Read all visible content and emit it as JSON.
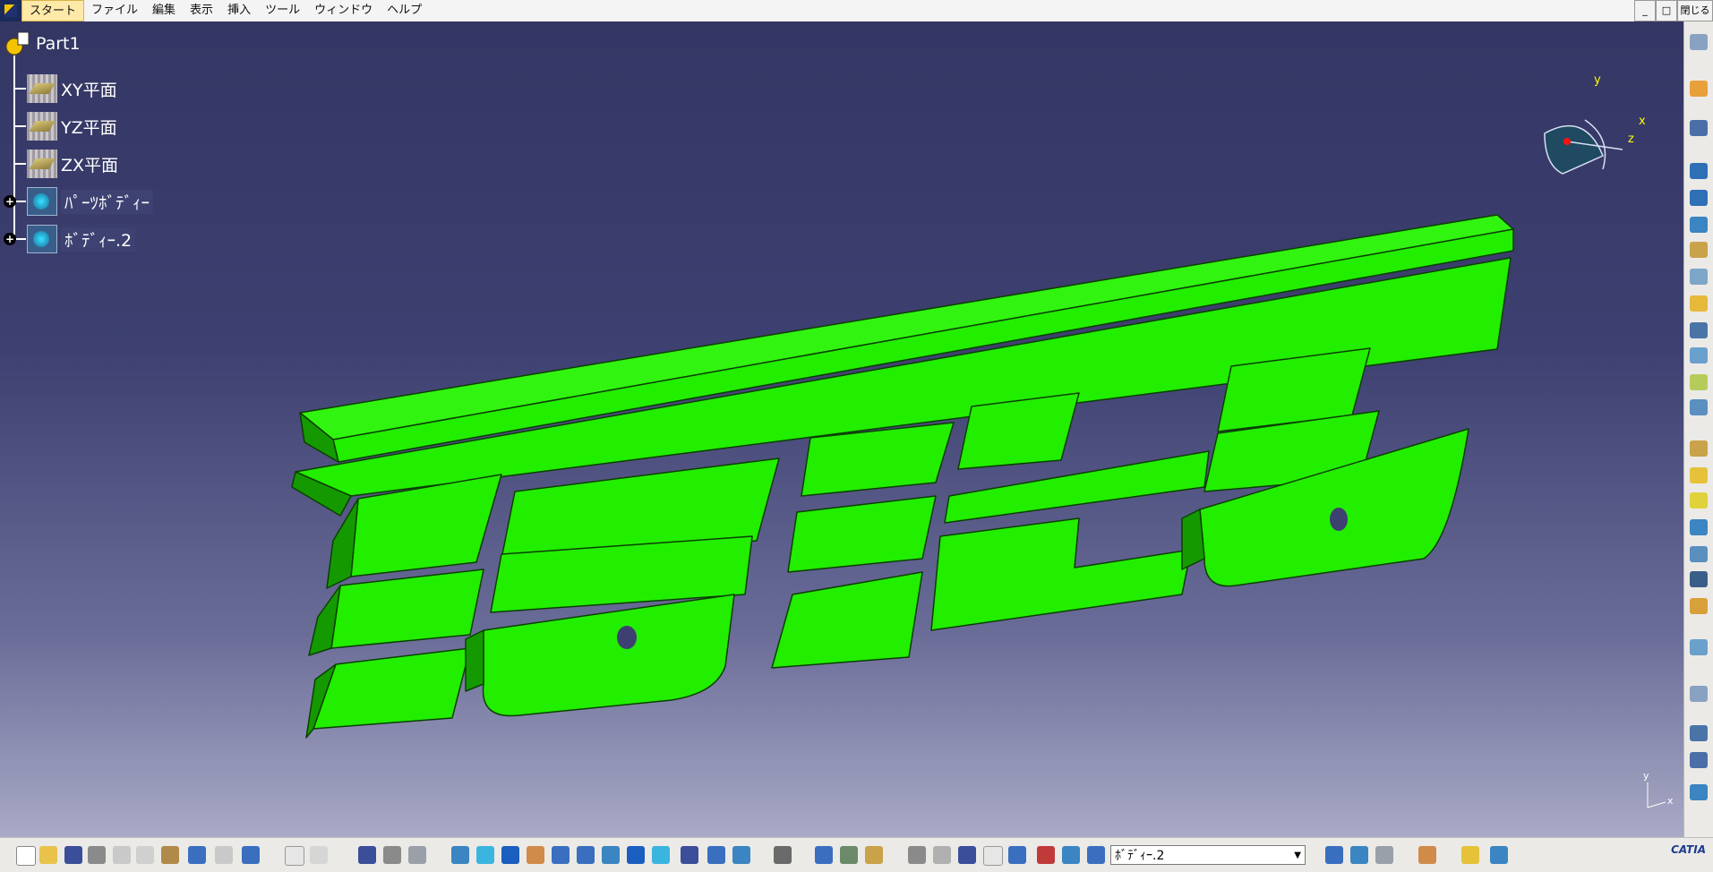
{
  "menu": {
    "items": [
      "スタート",
      "ファイル",
      "編集",
      "表示",
      "挿入",
      "ツール",
      "ウィンドウ",
      "ヘルプ"
    ],
    "close_label": "閉じる"
  },
  "tree": {
    "root": "Part1",
    "nodes": [
      {
        "label": "XY平面",
        "icon": "plane-icon"
      },
      {
        "label": "YZ平面",
        "icon": "plane-icon"
      },
      {
        "label": "ZX平面",
        "icon": "plane-icon"
      },
      {
        "label": "ﾊﾟｰﾂﾎﾞﾃﾞｨｰ",
        "icon": "body-icon",
        "expandable": true
      },
      {
        "label": "ﾎﾞﾃﾞｨｰ.2",
        "icon": "body-icon",
        "expandable": true
      }
    ]
  },
  "compass": {
    "x": "x",
    "y": "y",
    "z": "z"
  },
  "mini_axis": {
    "x": "x",
    "y": "y"
  },
  "toolbar": {
    "current_body": "ﾎﾞﾃﾞｨｰ.2",
    "logo": "CATIA"
  },
  "colors": {
    "viewport_top": "#343664",
    "viewport_bottom": "#a9aac6",
    "part_face": "#22ee00",
    "part_dark": "#0d8a00"
  }
}
